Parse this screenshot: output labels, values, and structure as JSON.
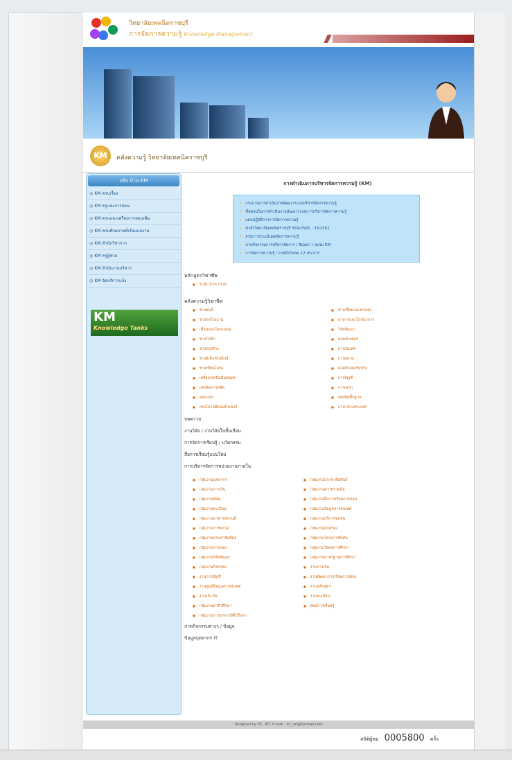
{
  "header": {
    "college": "วิทยาลัยเทคนิคราชบุรี",
    "km_thai": "การจัดการความรู้",
    "km_en": "Knowledge Management"
  },
  "subbar": {
    "logo": "KM",
    "title": "คลังความรู้  วิทยาลัยเทคนิคราชบุรี"
  },
  "sidebar": {
    "header": "ปรับ บ้าน KM",
    "items": [
      "KM ครบเรื่อง",
      "KM ครูและการสอน",
      "KM ครบและเครื่องการสอนเพิ่ม",
      "KM ครบศักยภาพที่เรียนแลงาน",
      "KM สำนักวิชาการ",
      "KM ครูผู้ช่วย",
      "KM สำนักงานบริหาร",
      "KM จัดบริการแจ้ง"
    ],
    "banner": "KM",
    "banner_sub": "Knowledge Tanks"
  },
  "main": {
    "title": "การดำเนินการบริหารจัดการความรู้ (KM)",
    "bluebox": [
      "กระบวนการดำเนินงานพัฒนาระบบบริหารจัดการความรู้",
      "ขั้นตอนในการดำเนินงานพัฒนาระบบการบริหารจัดการความรู้",
      "แผนปฏิบัติการการจัดการความรู้",
      "คำสั่งวิทยาลัยเทคนิคราชบุรี 569/2565 , 33/2561",
      "สรุปการประเมินผลจัดการความรู้",
      "ภาพกิจกรรมการบริหารจัดการ / สัมมนา / อบรม KM",
      "การจัดการความรู้ / ลายมือโหลด 12 ประการ"
    ],
    "section_curriculum": "หลักสูตรวิชาชีพ",
    "curriculum_item": "ระดับ ปวช./ปวส.",
    "section_knowledge": "คลังความรู้วิชาชีพ",
    "knowledge_left": [
      "ช่างยนต์",
      "ช่างกลโรงงาน",
      "เชื่อมและโลหะแผ่น",
      "ช่างไฟฟ้า",
      "ช่างก่อสร้าง",
      "ช่างอิเล็กทรอนิกส์",
      "ช่างเขียนโลหะ",
      "เครื่องกลเรือเดินสมุทร",
      "เทคนิคการผลิต",
      "ออกแบบ",
      "เทคโนโลยีคอมพิวเตอร์"
    ],
    "knowledge_right": [
      "ช่างเชื่อมและตกแต่ง",
      "อาหารและโภชนาการ",
      "วิจัยพัฒนา",
      "คอมพิวเตอร์",
      "สารสนเทศ",
      "การตลาด",
      "คอมพิวเตอร์ธุรกิจ",
      "การบัญชี",
      "การเลขา",
      "เทคนิคพื้นฐาน",
      "ภาษาต่างประเทศ"
    ],
    "links": [
      "บทความ",
      "งานวิจัย / งานวิจัยในชั้นเรียน",
      "การจัดการเรียนรู้ / นวัตกรรม",
      "สื่อการเรียนรู้แบบใหม่",
      "การบริหารจัดการหน่วยงานภายใน"
    ],
    "dept_left": [
      "กลุ่มงานบุคลากร",
      "กลุ่มงานการเงิน",
      "กลุ่มงานพัสดุ",
      "กลุ่มงานทะเบียน",
      "กลุ่มงานอาคารสถานที่",
      "กลุ่มงานการตลาด",
      "กลุ่มงานประชาสัมพันธ์",
      "กลุ่มงานวางแผน",
      "กลุ่มงานวิจัยพัฒนา",
      "กลุ่มงานกิจกรรม",
      "งานการบัญชี",
      "งานศูนย์ข้อมูลสารสนเทศ",
      "งานประกัน",
      "กลุ่มงานอาชีวศึกษา",
      "กลุ่มงานการอาจารย์ที่ปรึกษา"
    ],
    "dept_right": [
      "กลุ่มงานประชาสัมพันธ์",
      "กลุ่มงานความร่วมมือ",
      "กลุ่มงานสื่อการเรียนการสอน",
      "กลุ่มงานข้อมูลสารสนเทศ",
      "กลุ่มงานบริการชุมชน",
      "กลุ่มงานปกครอง",
      "กลุ่มงานโครงการพิเศษ",
      "กลุ่มงานวัดผลการศึกษา",
      "กลุ่มงานมาตรฐานการศึกษา",
      "งานการเงิน",
      "งานพัฒนาการเรียนการสอน",
      "งานหลักสูตร",
      "งานทะเบียน",
      "ศูนย์การเรียนรู้"
    ],
    "extra_links": [
      "ภาพกิจกรรมต่างๆ / ข้อมูล",
      "ข้อมูลบุคลากร IT"
    ]
  },
  "footer": {
    "designed": "Designed by ITC, RTC E-mail : itc_rat@hotmail.com",
    "visitors_label": "สถิติผู้ชม",
    "visitors": "0005800",
    "visitors_suffix": "ครั้ง"
  },
  "colors": {
    "accent": "#d2690f",
    "sidebar": "#d6eaf8",
    "header_red": "#9c1e1e"
  }
}
